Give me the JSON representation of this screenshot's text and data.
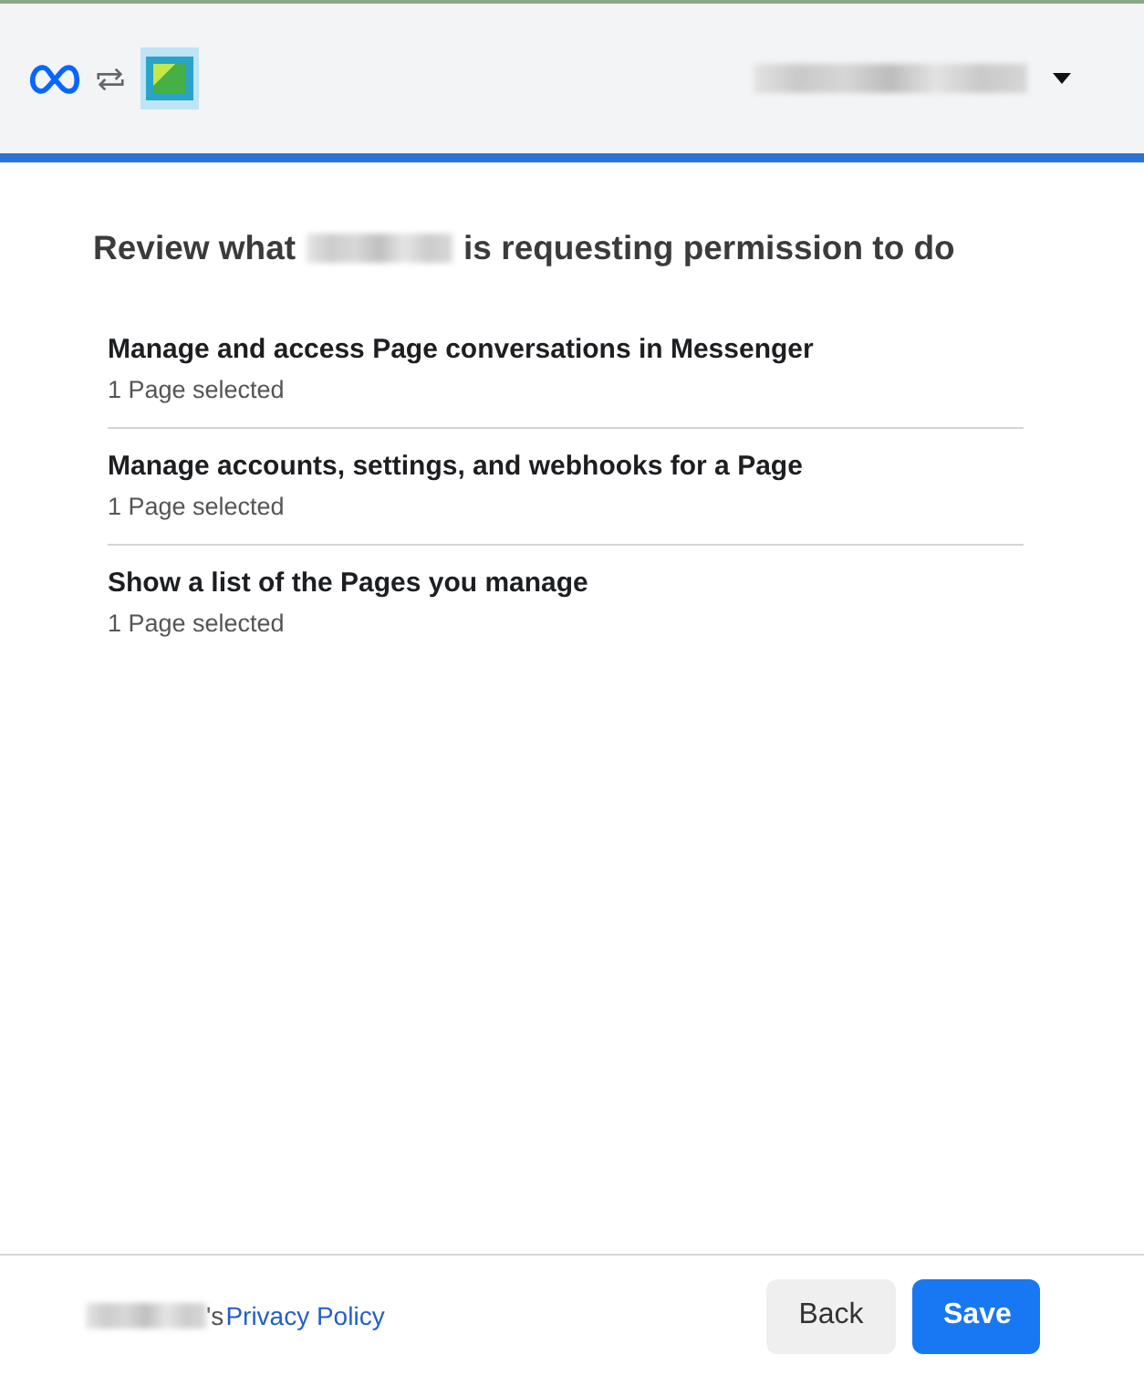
{
  "header": {
    "account_menu": {
      "expanded": false
    }
  },
  "heading": {
    "before": "Review what",
    "after": "is requesting permission to do"
  },
  "permissions": [
    {
      "title": "Manage and access Page conversations in Messenger",
      "detail": "1 Page selected"
    },
    {
      "title": "Manage accounts, settings, and webhooks for a Page",
      "detail": "1 Page selected"
    },
    {
      "title": "Show a list of the Pages you manage",
      "detail": "1 Page selected"
    }
  ],
  "footer": {
    "possessive": "'s",
    "policy_link": "Privacy Policy",
    "buttons": [
      {
        "label": "Back",
        "kind": "secondary"
      },
      {
        "label": "Save",
        "kind": "primary"
      }
    ]
  }
}
